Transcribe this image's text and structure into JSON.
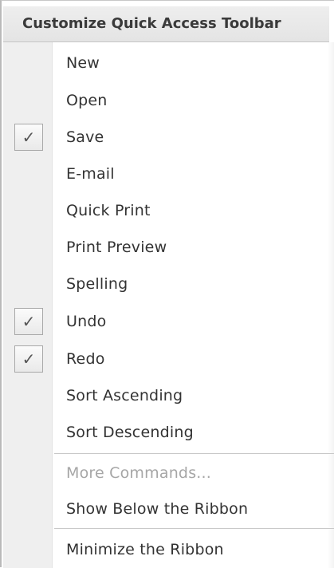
{
  "menu": {
    "title": "Customize Quick Access Toolbar",
    "items": [
      {
        "label": "New",
        "checked": false,
        "enabled": true
      },
      {
        "label": "Open",
        "checked": false,
        "enabled": true
      },
      {
        "label": "Save",
        "checked": true,
        "enabled": true
      },
      {
        "label": "E-mail",
        "checked": false,
        "enabled": true
      },
      {
        "label": "Quick Print",
        "checked": false,
        "enabled": true
      },
      {
        "label": "Print Preview",
        "checked": false,
        "enabled": true
      },
      {
        "label": "Spelling",
        "checked": false,
        "enabled": true
      },
      {
        "label": "Undo",
        "checked": true,
        "enabled": true
      },
      {
        "label": "Redo",
        "checked": true,
        "enabled": true
      },
      {
        "label": "Sort Ascending",
        "checked": false,
        "enabled": true
      },
      {
        "label": "Sort Descending",
        "checked": false,
        "enabled": true
      }
    ],
    "more_commands": "More Commands...",
    "show_below_ribbon": "Show Below the Ribbon",
    "minimize_ribbon": "Minimize the Ribbon",
    "check_glyph": "✓"
  }
}
